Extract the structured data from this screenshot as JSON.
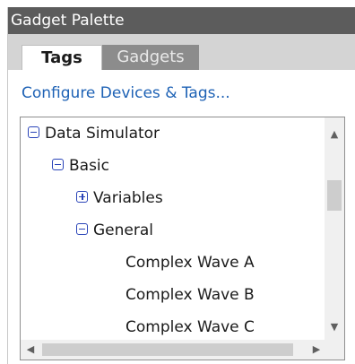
{
  "header": {
    "title": "Gadget Palette"
  },
  "tabs": {
    "tags": "Tags",
    "gadgets": "Gadgets"
  },
  "links": {
    "configure": "Configure Devices & Tags..."
  },
  "tree": {
    "items": [
      {
        "label": "Data Simulator",
        "state": "expanded"
      },
      {
        "label": "Basic",
        "state": "expanded"
      },
      {
        "label": "Variables",
        "state": "collapsed"
      },
      {
        "label": "General",
        "state": "expanded"
      },
      {
        "label": "Complex Wave A"
      },
      {
        "label": "Complex Wave B"
      },
      {
        "label": "Complex Wave C"
      }
    ]
  },
  "scrollbars": {
    "up": "▲",
    "down": "▼",
    "left": "◀",
    "right": "▶"
  },
  "colors": {
    "header_bg": "#5c5c5c",
    "tabbar_bg": "#d4d4d4",
    "active_tab_bg": "#ffffff",
    "inactive_tab_bg": "#8c8c8c",
    "link": "#1e62b5",
    "expander": "#2a44b8"
  },
  "icons": [
    "minus-box-icon",
    "plus-box-icon"
  ]
}
